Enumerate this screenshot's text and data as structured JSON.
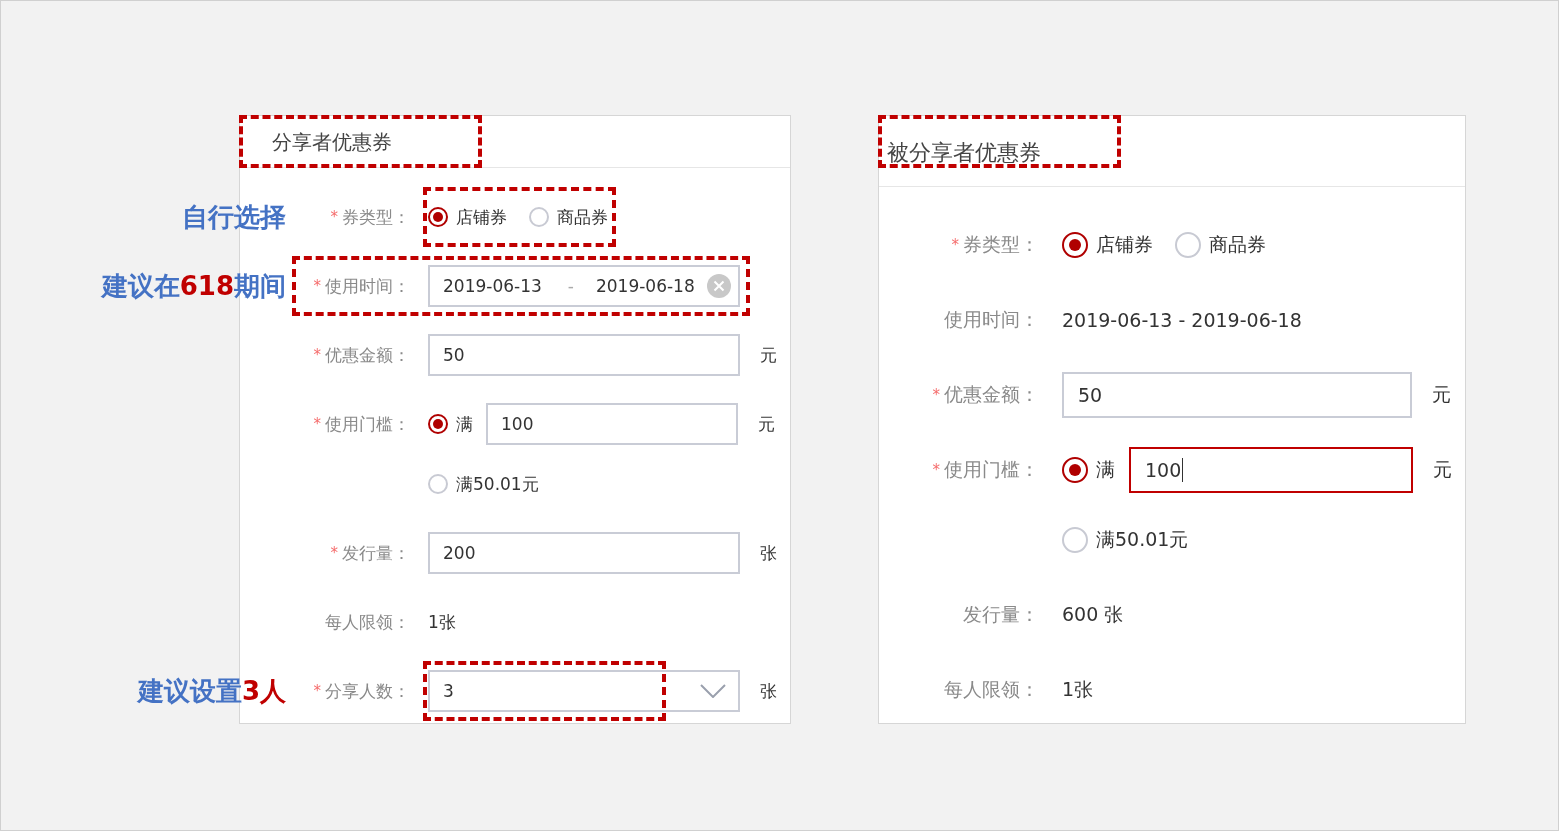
{
  "panels": [
    {
      "title": "分享者优惠券",
      "title_highlighted": true,
      "rows": [
        {
          "kind": "radio",
          "label": "券类型：",
          "required_mark": "*",
          "highlighted": true,
          "note": {
            "parts": [
              {
                "text": "自行选择",
                "emphasis": false
              }
            ]
          },
          "options": [
            {
              "label": "店铺券",
              "selected": true
            },
            {
              "label": "商品券",
              "selected": false
            }
          ]
        },
        {
          "kind": "daterange",
          "label": "使用时间：",
          "required_mark": "*",
          "highlighted": true,
          "note": {
            "parts": [
              {
                "text": "建议在",
                "emphasis": false
              },
              {
                "text": "618",
                "emphasis": true
              },
              {
                "text": "期间",
                "emphasis": false
              }
            ]
          },
          "start": "2019-06-13",
          "separator": "-",
          "end": "2019-06-18"
        },
        {
          "kind": "input",
          "label": "优惠金额：",
          "required_mark": "*",
          "value": "50",
          "unit": "元"
        },
        {
          "kind": "threshold",
          "label": "使用门槛：",
          "required_mark": "*",
          "options": [
            {
              "label": "满",
              "selected": true,
              "value": "100",
              "unit": "元",
              "focused": false
            },
            {
              "label": "满50.01元",
              "selected": false
            }
          ]
        },
        {
          "kind": "input",
          "label": "发行量：",
          "required_mark": "*",
          "value": "200",
          "unit": "张"
        },
        {
          "kind": "text",
          "label": "每人限领：",
          "value": "1张"
        },
        {
          "kind": "select",
          "label": "分享人数：",
          "required_mark": "*",
          "highlighted": true,
          "note": {
            "parts": [
              {
                "text": "建议设置",
                "emphasis": false
              },
              {
                "text": "3人",
                "emphasis": true
              }
            ]
          },
          "value": "3",
          "unit": "张"
        }
      ]
    },
    {
      "title": "被分享者优惠券",
      "title_highlighted": true,
      "rows": [
        {
          "kind": "radio",
          "label": "券类型：",
          "required_mark": "*",
          "options": [
            {
              "label": "店铺券",
              "selected": true
            },
            {
              "label": "商品券",
              "selected": false
            }
          ]
        },
        {
          "kind": "text",
          "label": "使用时间：",
          "value": "2019-06-13 - 2019-06-18"
        },
        {
          "kind": "input",
          "label": "优惠金额：",
          "required_mark": "*",
          "value": "50",
          "unit": "元"
        },
        {
          "kind": "threshold",
          "label": "使用门槛：",
          "required_mark": "*",
          "options": [
            {
              "label": "满",
              "selected": true,
              "value": "100",
              "unit": "元",
              "focused": true
            },
            {
              "label": "满50.01元",
              "selected": false
            }
          ]
        },
        {
          "kind": "text",
          "label": "发行量：",
          "value": "600 张"
        },
        {
          "kind": "text",
          "label": "每人限领：",
          "value": "1张"
        }
      ]
    }
  ]
}
